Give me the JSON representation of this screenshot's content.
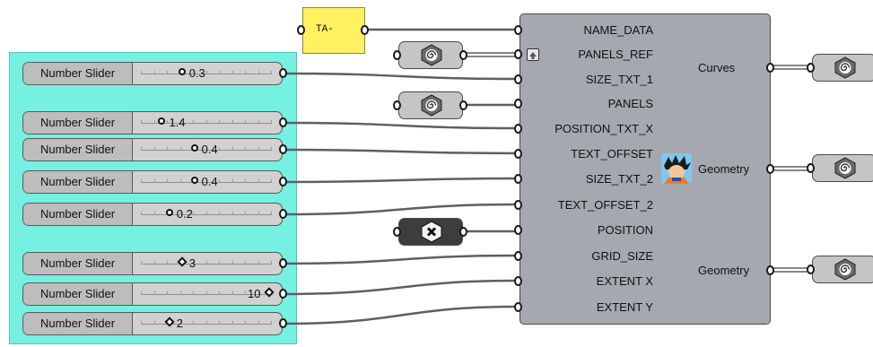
{
  "panel": {
    "text": "TA-"
  },
  "component": {
    "inputs": [
      "NAME_DATA",
      "PANELS_REF",
      "SIZE_TXT_1",
      "PANELS",
      "POSITION_TXT_X",
      "TEXT_OFFSET",
      "SIZE_TXT_2",
      "TEXT_OFFSET_2",
      "POSITION",
      "GRID_SIZE",
      "EXTENT X",
      "EXTENT Y"
    ],
    "outputs": [
      "Curves",
      "Geometry",
      "Geometry"
    ]
  },
  "sliders": [
    {
      "label": "Number Slider",
      "value": "0.3",
      "fraction": 0.3,
      "knob": "circle"
    },
    {
      "label": "Number Slider",
      "value": "1.4",
      "fraction": 0.14,
      "knob": "circle"
    },
    {
      "label": "Number Slider",
      "value": "0.4",
      "fraction": 0.4,
      "knob": "circle"
    },
    {
      "label": "Number Slider",
      "value": "0.4",
      "fraction": 0.4,
      "knob": "circle"
    },
    {
      "label": "Number Slider",
      "value": "0.2",
      "fraction": 0.2,
      "knob": "circle"
    },
    {
      "label": "Number Slider",
      "value": "3",
      "fraction": 0.3,
      "knob": "diamond"
    },
    {
      "label": "Number Slider",
      "value": "10",
      "fraction": 1.0,
      "knob": "diamond"
    },
    {
      "label": "Number Slider",
      "value": "2",
      "fraction": 0.2,
      "knob": "diamond"
    }
  ],
  "params": [
    {
      "icon": "geometry-param-icon",
      "style": "light"
    },
    {
      "icon": "geometry-param-icon",
      "style": "light"
    },
    {
      "icon": "null-param-icon",
      "style": "dark"
    },
    {
      "icon": "geometry-param-icon",
      "style": "light"
    },
    {
      "icon": "geometry-param-icon",
      "style": "light"
    },
    {
      "icon": "geometry-param-icon",
      "style": "light"
    }
  ],
  "colors": {
    "group": "#76f1e1",
    "panel": "#fff15f",
    "component": "#a5a8ae",
    "wire": "#5f5f5f"
  }
}
